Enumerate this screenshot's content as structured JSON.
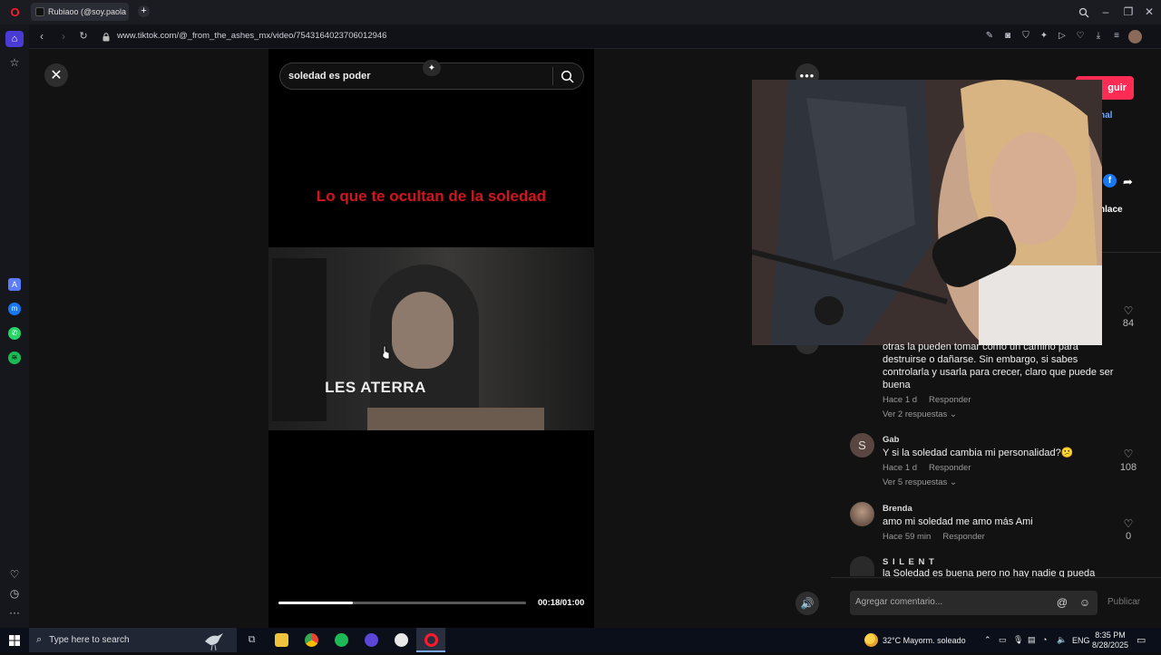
{
  "browser": {
    "tab_title": "Rubiaoo (@soy.paola",
    "new_tab": "+",
    "url": "www.tiktok.com/@_from_the_ashes_mx/video/7543164023706012946"
  },
  "player": {
    "search_value": "soledad es poder",
    "video_title": "Lo que te ocultan de la soledad",
    "video_caption": "LES ATERRA",
    "time": "00:18/01:00",
    "progress_fraction": 0.3
  },
  "right_panel": {
    "follow_label": "guir",
    "original_link": "nal",
    "copy_link": "nlace",
    "composer_placeholder": "Agregar comentario...",
    "publish_label": "Publicar"
  },
  "comments": [
    {
      "name": "",
      "text_lines": [
        "otras la pueden tomar como un camino para",
        "destruirse o dañarse. Sin embargo, si sabes",
        "controlarla y usarla para crecer, claro que puede ser",
        "buena"
      ],
      "time": "Hace 1 d",
      "reply": "Responder",
      "replies": "Ver 2 respuestas",
      "likes": "84"
    },
    {
      "name": "Gab",
      "text_lines": [
        "Y si la soledad cambia mi personalidad?😕"
      ],
      "time": "Hace 1 d",
      "reply": "Responder",
      "replies": "Ver 5 respuestas",
      "likes": "108",
      "avatar_letter": "S"
    },
    {
      "name": "Brenda",
      "text_lines": [
        "amo mi soledad me amo más Ami"
      ],
      "time": "Hace 59 min",
      "reply": "Responder",
      "likes": "0"
    },
    {
      "name": "S I L E N T",
      "text_lines": [
        "la Soledad es buena pero no hay nadie q pueda"
      ]
    }
  ],
  "taskbar": {
    "search_placeholder": "Type here to search",
    "weather": "32°C  Mayorm. soleado",
    "lang": "ENG",
    "time": "8:35 PM",
    "date": "8/28/2025"
  },
  "colors": {
    "tiktok_red": "#fe2c55",
    "video_title_red": "#d0161c",
    "opera_red": "#ff1b2d"
  }
}
